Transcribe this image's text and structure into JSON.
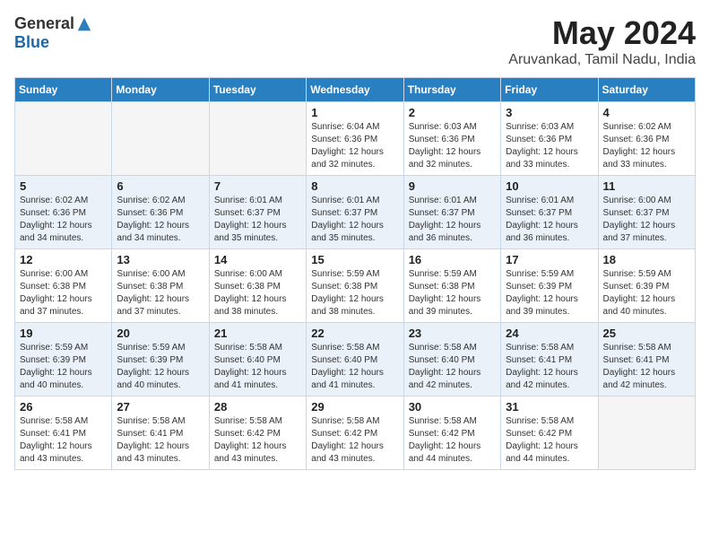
{
  "header": {
    "logo_general": "General",
    "logo_blue": "Blue",
    "month_year": "May 2024",
    "location": "Aruvankad, Tamil Nadu, India"
  },
  "weekdays": [
    "Sunday",
    "Monday",
    "Tuesday",
    "Wednesday",
    "Thursday",
    "Friday",
    "Saturday"
  ],
  "weeks": [
    [
      {
        "day": "",
        "info": ""
      },
      {
        "day": "",
        "info": ""
      },
      {
        "day": "",
        "info": ""
      },
      {
        "day": "1",
        "info": "Sunrise: 6:04 AM\nSunset: 6:36 PM\nDaylight: 12 hours\nand 32 minutes."
      },
      {
        "day": "2",
        "info": "Sunrise: 6:03 AM\nSunset: 6:36 PM\nDaylight: 12 hours\nand 32 minutes."
      },
      {
        "day": "3",
        "info": "Sunrise: 6:03 AM\nSunset: 6:36 PM\nDaylight: 12 hours\nand 33 minutes."
      },
      {
        "day": "4",
        "info": "Sunrise: 6:02 AM\nSunset: 6:36 PM\nDaylight: 12 hours\nand 33 minutes."
      }
    ],
    [
      {
        "day": "5",
        "info": "Sunrise: 6:02 AM\nSunset: 6:36 PM\nDaylight: 12 hours\nand 34 minutes."
      },
      {
        "day": "6",
        "info": "Sunrise: 6:02 AM\nSunset: 6:36 PM\nDaylight: 12 hours\nand 34 minutes."
      },
      {
        "day": "7",
        "info": "Sunrise: 6:01 AM\nSunset: 6:37 PM\nDaylight: 12 hours\nand 35 minutes."
      },
      {
        "day": "8",
        "info": "Sunrise: 6:01 AM\nSunset: 6:37 PM\nDaylight: 12 hours\nand 35 minutes."
      },
      {
        "day": "9",
        "info": "Sunrise: 6:01 AM\nSunset: 6:37 PM\nDaylight: 12 hours\nand 36 minutes."
      },
      {
        "day": "10",
        "info": "Sunrise: 6:01 AM\nSunset: 6:37 PM\nDaylight: 12 hours\nand 36 minutes."
      },
      {
        "day": "11",
        "info": "Sunrise: 6:00 AM\nSunset: 6:37 PM\nDaylight: 12 hours\nand 37 minutes."
      }
    ],
    [
      {
        "day": "12",
        "info": "Sunrise: 6:00 AM\nSunset: 6:38 PM\nDaylight: 12 hours\nand 37 minutes."
      },
      {
        "day": "13",
        "info": "Sunrise: 6:00 AM\nSunset: 6:38 PM\nDaylight: 12 hours\nand 37 minutes."
      },
      {
        "day": "14",
        "info": "Sunrise: 6:00 AM\nSunset: 6:38 PM\nDaylight: 12 hours\nand 38 minutes."
      },
      {
        "day": "15",
        "info": "Sunrise: 5:59 AM\nSunset: 6:38 PM\nDaylight: 12 hours\nand 38 minutes."
      },
      {
        "day": "16",
        "info": "Sunrise: 5:59 AM\nSunset: 6:38 PM\nDaylight: 12 hours\nand 39 minutes."
      },
      {
        "day": "17",
        "info": "Sunrise: 5:59 AM\nSunset: 6:39 PM\nDaylight: 12 hours\nand 39 minutes."
      },
      {
        "day": "18",
        "info": "Sunrise: 5:59 AM\nSunset: 6:39 PM\nDaylight: 12 hours\nand 40 minutes."
      }
    ],
    [
      {
        "day": "19",
        "info": "Sunrise: 5:59 AM\nSunset: 6:39 PM\nDaylight: 12 hours\nand 40 minutes."
      },
      {
        "day": "20",
        "info": "Sunrise: 5:59 AM\nSunset: 6:39 PM\nDaylight: 12 hours\nand 40 minutes."
      },
      {
        "day": "21",
        "info": "Sunrise: 5:58 AM\nSunset: 6:40 PM\nDaylight: 12 hours\nand 41 minutes."
      },
      {
        "day": "22",
        "info": "Sunrise: 5:58 AM\nSunset: 6:40 PM\nDaylight: 12 hours\nand 41 minutes."
      },
      {
        "day": "23",
        "info": "Sunrise: 5:58 AM\nSunset: 6:40 PM\nDaylight: 12 hours\nand 42 minutes."
      },
      {
        "day": "24",
        "info": "Sunrise: 5:58 AM\nSunset: 6:41 PM\nDaylight: 12 hours\nand 42 minutes."
      },
      {
        "day": "25",
        "info": "Sunrise: 5:58 AM\nSunset: 6:41 PM\nDaylight: 12 hours\nand 42 minutes."
      }
    ],
    [
      {
        "day": "26",
        "info": "Sunrise: 5:58 AM\nSunset: 6:41 PM\nDaylight: 12 hours\nand 43 minutes."
      },
      {
        "day": "27",
        "info": "Sunrise: 5:58 AM\nSunset: 6:41 PM\nDaylight: 12 hours\nand 43 minutes."
      },
      {
        "day": "28",
        "info": "Sunrise: 5:58 AM\nSunset: 6:42 PM\nDaylight: 12 hours\nand 43 minutes."
      },
      {
        "day": "29",
        "info": "Sunrise: 5:58 AM\nSunset: 6:42 PM\nDaylight: 12 hours\nand 43 minutes."
      },
      {
        "day": "30",
        "info": "Sunrise: 5:58 AM\nSunset: 6:42 PM\nDaylight: 12 hours\nand 44 minutes."
      },
      {
        "day": "31",
        "info": "Sunrise: 5:58 AM\nSunset: 6:42 PM\nDaylight: 12 hours\nand 44 minutes."
      },
      {
        "day": "",
        "info": ""
      }
    ]
  ]
}
